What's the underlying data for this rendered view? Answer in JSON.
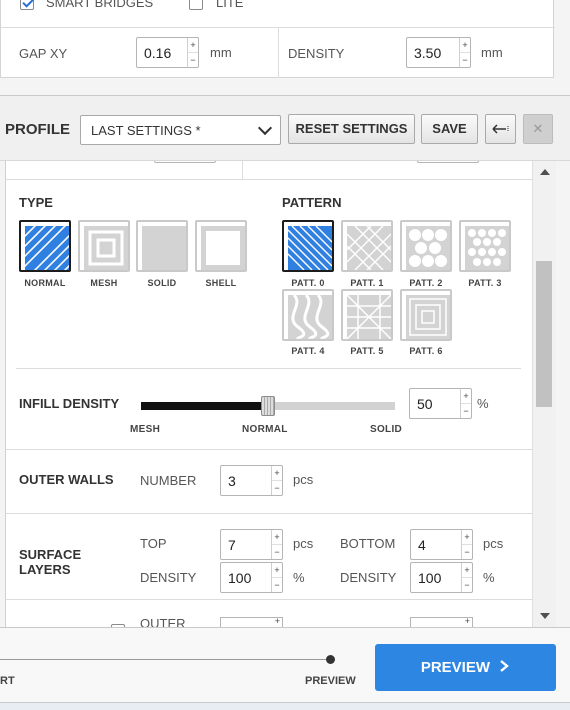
{
  "upper": {
    "smart_bridges_label": "SMART BRIDGES",
    "smart_bridges_checked": true,
    "lite_label": "LITE",
    "lite_checked": false,
    "gap_xy": {
      "label": "GAP XY",
      "value": "0.16",
      "unit": "mm"
    },
    "density": {
      "label": "DENSITY",
      "value": "3.50",
      "unit": "mm"
    }
  },
  "profile": {
    "label": "PROFILE",
    "selected": "LAST SETTINGS *",
    "reset_label": "RESET SETTINGS",
    "save_label": "SAVE",
    "import_icon": "arrow-left-icon",
    "close_icon": "close-icon"
  },
  "infill": {
    "type_title": "TYPE",
    "types": [
      {
        "label": "NORMAL",
        "selected": true
      },
      {
        "label": "MESH",
        "selected": false
      },
      {
        "label": "SOLID",
        "selected": false
      },
      {
        "label": "SHELL",
        "selected": false
      }
    ],
    "pattern_title": "PATTERN",
    "patterns": [
      {
        "label": "PATT. 0",
        "selected": true
      },
      {
        "label": "PATT. 1",
        "selected": false
      },
      {
        "label": "PATT. 2",
        "selected": false
      },
      {
        "label": "PATT. 3",
        "selected": false
      },
      {
        "label": "PATT. 4",
        "selected": false
      },
      {
        "label": "PATT. 5",
        "selected": false
      },
      {
        "label": "PATT. 6",
        "selected": false
      }
    ],
    "density_title": "INFILL DENSITY",
    "density_value": "50",
    "density_unit": "%",
    "slider_fraction": 0.5,
    "slider_labels": [
      "MESH",
      "NORMAL",
      "SOLID"
    ]
  },
  "outer_walls": {
    "title": "OUTER WALLS",
    "number_label": "NUMBER",
    "value": "3",
    "unit": "pcs"
  },
  "surface_layers": {
    "title_line1": "SURFACE",
    "title_line2": "LAYERS",
    "top": {
      "label": "TOP",
      "value": "7",
      "unit": "pcs"
    },
    "bottom": {
      "label": "BOTTOM",
      "value": "4",
      "unit": "pcs"
    },
    "top_density": {
      "label": "DENSITY",
      "value": "100",
      "unit": "%"
    },
    "bottom_density": {
      "label": "DENSITY",
      "value": "100",
      "unit": "%"
    }
  },
  "partial_row": {
    "label": "OUTER"
  },
  "footer": {
    "start_label_fragment": "RT",
    "preview_step_label": "PREVIEW",
    "preview_button_label": "PREVIEW",
    "preview_icon": "chevron-right-icon"
  },
  "colors": {
    "accent": "#2d86e2",
    "selected_tile_fill": "#2f80e0",
    "slider_fill": "#111111"
  }
}
